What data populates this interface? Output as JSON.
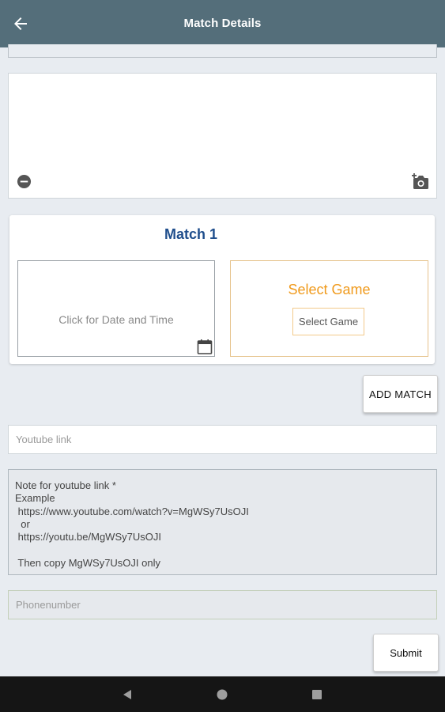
{
  "header": {
    "title": "Match Details",
    "back_icon": "arrow-left-icon"
  },
  "image_section": {
    "remove_icon": "minus-circle-icon",
    "add_photo_icon": "camera-plus-icon"
  },
  "match": {
    "title": "Match 1",
    "date_placeholder": "Click for Date and Time",
    "calendar_icon": "calendar-icon",
    "game_title": "Select Game",
    "game_button": "Select Game"
  },
  "add_match_button": "ADD MATCH",
  "youtube": {
    "placeholder": "Youtube link"
  },
  "note": {
    "text": "Note for youtube link *\nExample\n https://www.youtube.com/watch?v=MgWSy7UsOJI\n  or\n https://youtu.be/MgWSy7UsOJI\n\n Then copy MgWSy7UsOJI only"
  },
  "phone": {
    "placeholder": "Phonenumber"
  },
  "submit_button": "Submit",
  "navbar": {
    "back_icon": "nav-back-icon",
    "home_icon": "nav-home-icon",
    "recent_icon": "nav-recent-icon"
  },
  "colors": {
    "appbar": "#546e7a",
    "accent_blue": "#1f4e8c",
    "accent_orange": "#f09a1c"
  }
}
